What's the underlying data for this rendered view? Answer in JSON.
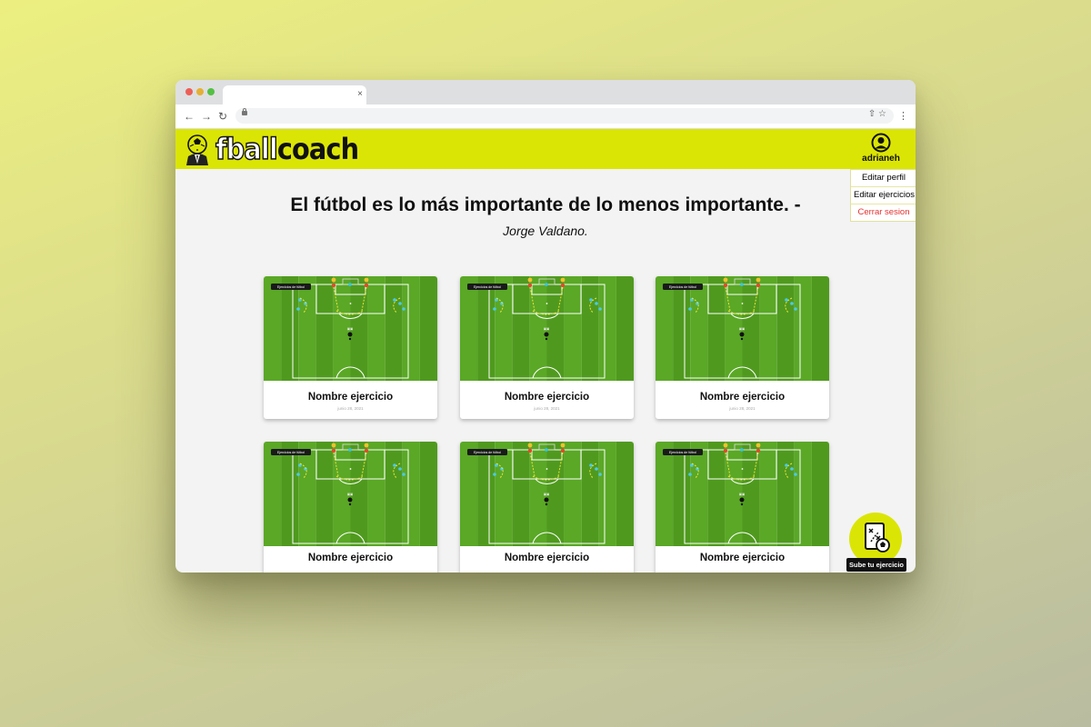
{
  "browser": {
    "tab_close": "×",
    "nav": {
      "back": "←",
      "forward": "→",
      "reload": "↻"
    },
    "omnibox_icons": "⇧  ☆",
    "menu": "⋮"
  },
  "header": {
    "logo_part1": "fball",
    "logo_part2": "coach",
    "username": "adrianeh",
    "brand_color": "#dbe505"
  },
  "user_menu": {
    "items": [
      "Editar perfil",
      "Editar ejercicios",
      "Cerrar sesion"
    ]
  },
  "quote": {
    "text": "El fútbol es lo más importante de lo menos importante. -",
    "author": "Jorge Valdano."
  },
  "exercises": [
    {
      "badge": "Ejercicios de fútbol",
      "title": "Nombre ejercicio",
      "date": "junio 28, 2021"
    },
    {
      "badge": "Ejercicios de fútbol",
      "title": "Nombre ejercicio",
      "date": "junio 28, 2021"
    },
    {
      "badge": "Ejercicios de fútbol",
      "title": "Nombre ejercicio",
      "date": "junio 28, 2021"
    },
    {
      "badge": "Ejercicios de fútbol",
      "title": "Nombre ejercicio",
      "date": ""
    },
    {
      "badge": "Ejercicios de fútbol",
      "title": "Nombre ejercicio",
      "date": ""
    },
    {
      "badge": "Ejercicios de fútbol",
      "title": "Nombre ejercicio",
      "date": ""
    }
  ],
  "fab": {
    "label": "Sube tu ejercicio",
    "icon": "tactics-board-icon"
  }
}
